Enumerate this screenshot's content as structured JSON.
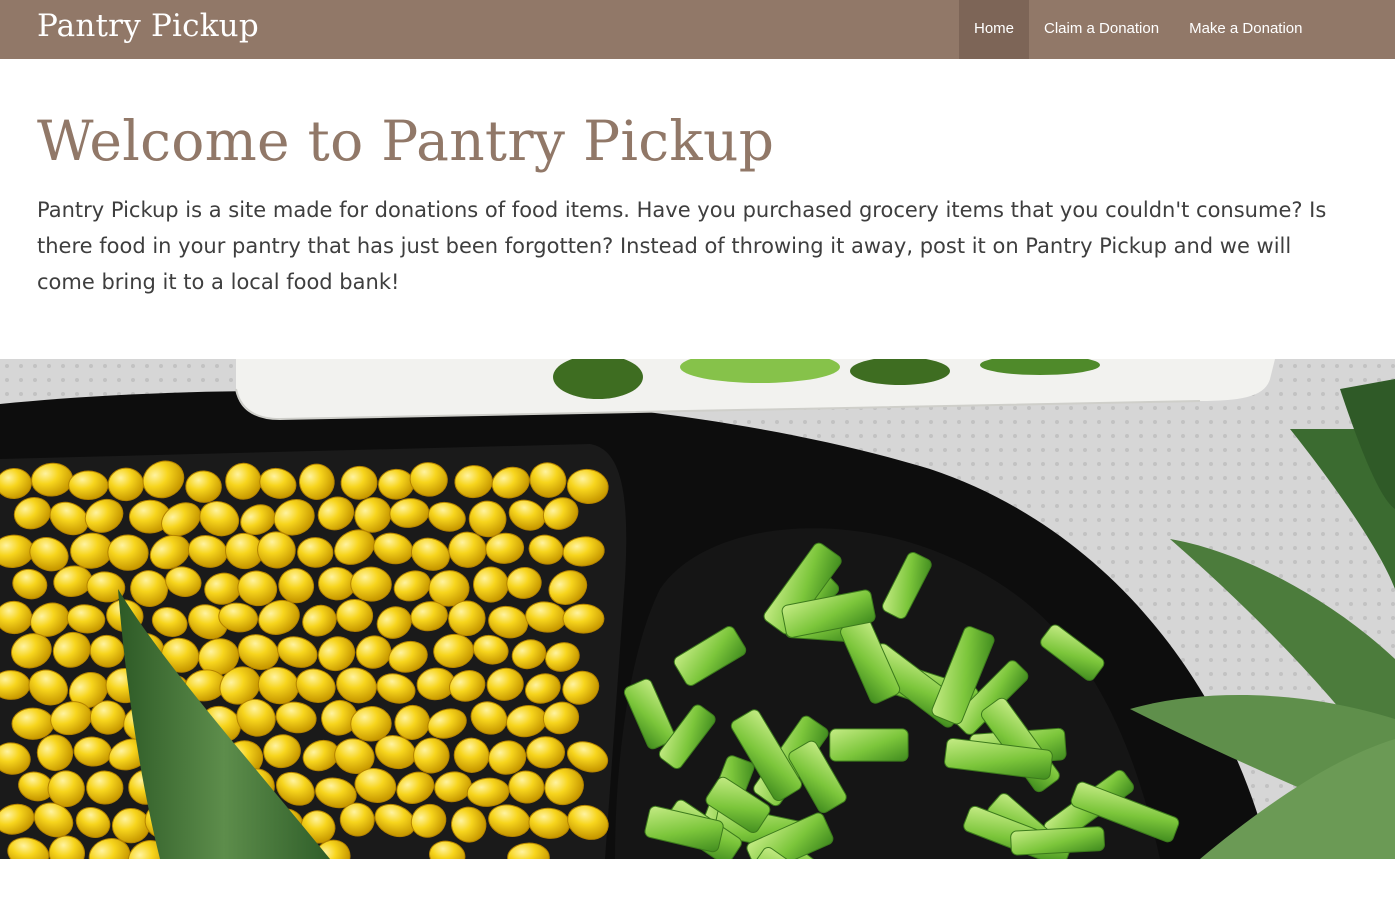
{
  "header": {
    "brand": "Pantry Pickup",
    "nav": [
      {
        "label": "Home",
        "active": true
      },
      {
        "label": "Claim a Donation",
        "active": false
      },
      {
        "label": "Make a Donation",
        "active": false
      }
    ]
  },
  "main": {
    "title": "Welcome to Pantry Pickup",
    "description": "Pantry Pickup is a site made for donations of food items. Have you purchased grocery items that you couldn't consume? Is there food in your pantry that has just been forgotten? Instead of throwing it away, post it on Pantry Pickup and we will come bring it to a local food bank!"
  },
  "colors": {
    "navbar": "#917868",
    "nav_active": "#7d6557",
    "title": "#917868"
  },
  "hero": {
    "subject": "food-photo-corn-asparagus-broccoli"
  }
}
